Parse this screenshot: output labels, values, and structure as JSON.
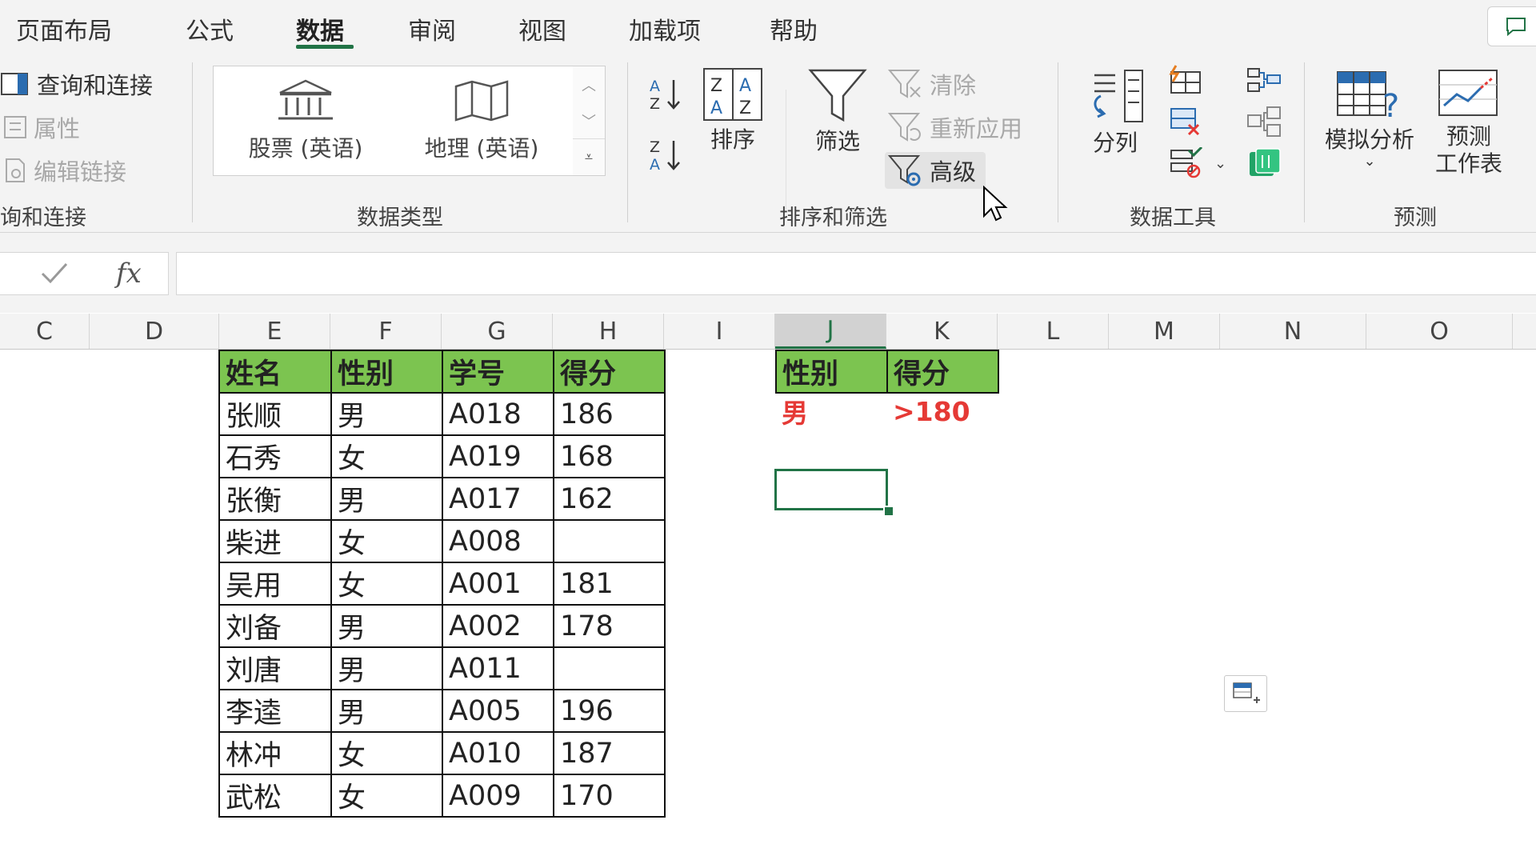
{
  "tabs": [
    {
      "label": "页面布局"
    },
    {
      "label": "公式"
    },
    {
      "label": "数据"
    },
    {
      "label": "审阅"
    },
    {
      "label": "视图"
    },
    {
      "label": "加载项"
    },
    {
      "label": "帮助"
    }
  ],
  "active_tab": "数据",
  "ribbon": {
    "queries": {
      "items": [
        {
          "label": "查询和连接"
        },
        {
          "label": "属性"
        },
        {
          "label": "编辑链接"
        }
      ],
      "group_label": "询和连接"
    },
    "data_types": {
      "items": [
        {
          "label": "股票 (英语)"
        },
        {
          "label": "地理 (英语)"
        }
      ],
      "group_label": "数据类型"
    },
    "sort_filter": {
      "sort_label": "排序",
      "filter_label": "筛选",
      "clear_label": "清除",
      "reapply_label": "重新应用",
      "advanced_label": "高级",
      "group_label": "排序和筛选"
    },
    "data_tools": {
      "split_label": "分列",
      "group_label": "数据工具"
    },
    "forecast": {
      "whatif_label": "模拟分析",
      "sheet_label_line1": "预测",
      "sheet_label_line2": "工作表",
      "group_label": "预测"
    }
  },
  "formula_bar": {
    "fx": "fx",
    "value": ""
  },
  "columns": [
    "C",
    "D",
    "E",
    "F",
    "G",
    "H",
    "I",
    "J",
    "K",
    "L",
    "M",
    "N",
    "O"
  ],
  "selected_column": "J",
  "table": {
    "headers": [
      "姓名",
      "性别",
      "学号",
      "得分"
    ],
    "rows": [
      [
        "张顺",
        "男",
        "A018",
        "186"
      ],
      [
        "石秀",
        "女",
        "A019",
        "168"
      ],
      [
        "张衡",
        "男",
        "A017",
        "162"
      ],
      [
        "柴进",
        "女",
        "A008",
        ""
      ],
      [
        "吴用",
        "女",
        "A001",
        "181"
      ],
      [
        "刘备",
        "男",
        "A002",
        "178"
      ],
      [
        "刘唐",
        "男",
        "A011",
        ""
      ],
      [
        "李逵",
        "男",
        "A005",
        "196"
      ],
      [
        "林冲",
        "女",
        "A010",
        "187"
      ],
      [
        "武松",
        "女",
        "A009",
        "170"
      ]
    ]
  },
  "criteria": {
    "headers": [
      "性别",
      "得分"
    ],
    "values": [
      "男",
      ">180"
    ]
  },
  "colors": {
    "accent": "#217346",
    "header_fill": "#7cc450",
    "criteria_text": "#e53935"
  }
}
